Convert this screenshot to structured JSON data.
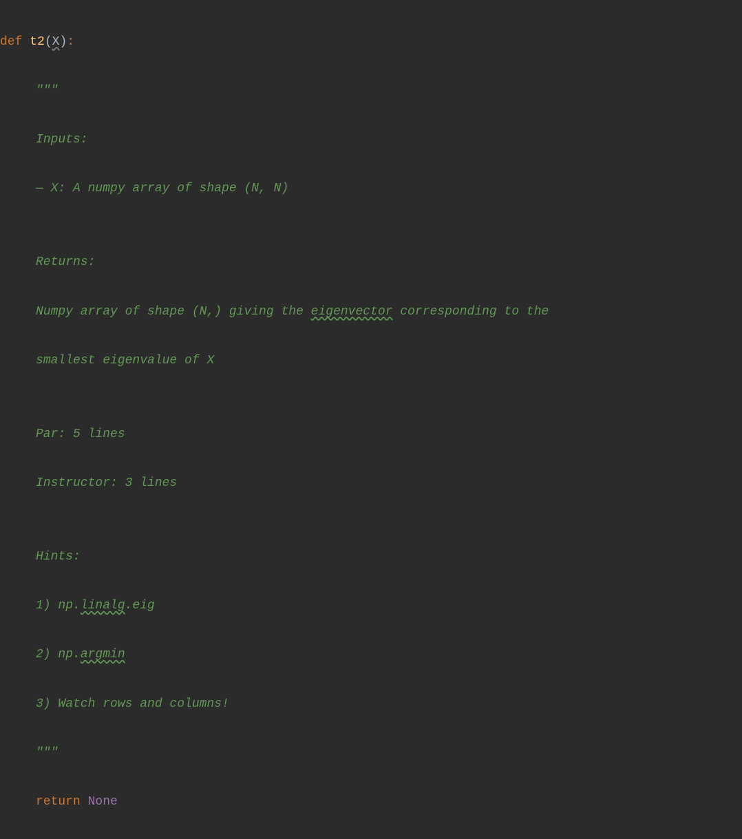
{
  "code": {
    "def_kw": "def",
    "func_name": "t2",
    "open_paren": "(",
    "param": "X",
    "close_paren": ")",
    "colon": ":",
    "docstring_open": "\"\"\"",
    "doc_inputs": "Inputs:",
    "doc_inputs_line": "— X: A numpy array of shape (N, N)",
    "doc_blank1": "",
    "doc_returns": "Returns:",
    "doc_returns_line1a": "Numpy array of shape (N,) giving the ",
    "doc_returns_eigenvector": "eigenvector",
    "doc_returns_line1b": " corresponding to the",
    "doc_returns_line2": "smallest eigenvalue of X",
    "doc_blank2": "",
    "doc_par": "Par: 5 lines",
    "doc_instructor": "Instructor: 3 lines",
    "doc_blank3": "",
    "doc_hints": "Hints:",
    "doc_hint1a": "1) np.",
    "doc_hint1_linalg": "linalg",
    "doc_hint1b": ".eig",
    "doc_hint2a": "2) np.",
    "doc_hint2_argmin": "argmin",
    "doc_hint3": "3) Watch rows and columns!",
    "docstring_close": "\"\"\"",
    "return_kw": "return",
    "none_kw": "None"
  }
}
